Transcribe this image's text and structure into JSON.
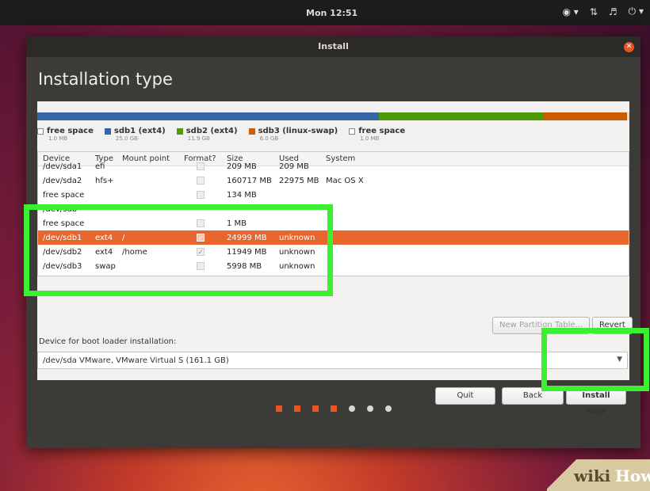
{
  "topbar": {
    "clock": "Mon 12:51",
    "tray_icons": [
      "accessibility-icon",
      "network-icon",
      "volume-icon",
      "power-icon"
    ]
  },
  "window": {
    "title": "Install",
    "heading": "Installation type"
  },
  "partition_bar": {
    "segments": [
      {
        "color": "#3465a4",
        "fraction": 0.577
      },
      {
        "color": "#4e9a06",
        "fraction": 0.279
      },
      {
        "color": "#ce5c00",
        "fraction": 0.14
      },
      {
        "color": "#dddddd",
        "fraction": 0.004
      }
    ]
  },
  "legend": [
    {
      "label": "free space",
      "size": "1.0 MB",
      "color": "empty"
    },
    {
      "label": "sdb1 (ext4)",
      "size": "25.0 GB",
      "color": "#3465a4"
    },
    {
      "label": "sdb2 (ext4)",
      "size": "11.9 GB",
      "color": "#4e9a06"
    },
    {
      "label": "sdb3 (linux-swap)",
      "size": "6.0 GB",
      "color": "#ce5c00"
    },
    {
      "label": "free space",
      "size": "1.0 MB",
      "color": "empty"
    }
  ],
  "table": {
    "headers": {
      "device": "Device",
      "type": "Type",
      "mount": "Mount point",
      "format": "Format?",
      "size": "Size",
      "used": "Used",
      "system": "System"
    },
    "rows": [
      {
        "device": "/dev/sda1",
        "type": "efi",
        "mount": "",
        "size": "209 MB",
        "used": "209 MB",
        "system": ""
      },
      {
        "device": "/dev/sda2",
        "type": "hfs+",
        "mount": "",
        "size": "160717 MB",
        "used": "22975 MB",
        "system": "Mac OS X"
      },
      {
        "device": "free space",
        "type": "",
        "mount": "",
        "size": "134 MB",
        "used": "",
        "system": ""
      },
      {
        "device": "/dev/sdb",
        "type": "",
        "mount": "",
        "size": "",
        "used": "",
        "system": ""
      },
      {
        "device": "free space",
        "type": "",
        "mount": "",
        "size": "1 MB",
        "used": "",
        "system": ""
      },
      {
        "device": "/dev/sdb1",
        "type": "ext4",
        "mount": "/",
        "size": "24999 MB",
        "used": "unknown",
        "system": ""
      },
      {
        "device": "/dev/sdb2",
        "type": "ext4",
        "mount": "/home",
        "size": "11949 MB",
        "used": "unknown",
        "system": ""
      },
      {
        "device": "/dev/sdb3",
        "type": "swap",
        "mount": "",
        "size": "5998 MB",
        "used": "unknown",
        "system": ""
      }
    ]
  },
  "buttons": {
    "new_partition_table": "New Partition Table...",
    "revert": "Revert",
    "quit": "Quit",
    "back": "Back",
    "install_now": "Install Now"
  },
  "boot_loader": {
    "label": "Device for boot loader installation:",
    "device": "/dev/sda",
    "description": "VMware, VMware Virtual S (161.1 GB)"
  },
  "progress_dots": {
    "total": 7,
    "completed": 4
  },
  "watermark": {
    "part1": "wiki",
    "part2": "How"
  }
}
